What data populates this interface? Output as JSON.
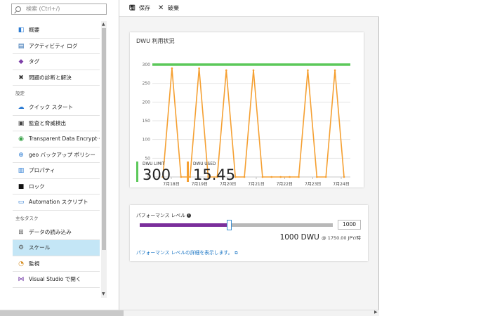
{
  "search": {
    "placeholder": "検索 (Ctrl+/)"
  },
  "toolbar": {
    "save_label": "保存",
    "discard_label": "破棄"
  },
  "sidebar": {
    "items_top": [
      {
        "label": "概要",
        "icon": "overview-icon",
        "glyph": "◧",
        "color": "#2b7bd3"
      },
      {
        "label": "アクティビティ ログ",
        "icon": "activity-log-icon",
        "glyph": "▤",
        "color": "#1a5fa8"
      },
      {
        "label": "タグ",
        "icon": "tag-icon",
        "glyph": "◆",
        "color": "#7d3fa8"
      },
      {
        "label": "問題の診断と解決",
        "icon": "wrench-icon",
        "glyph": "✖",
        "color": "#333333"
      }
    ],
    "section_settings": "設定",
    "items_settings": [
      {
        "label": "クイック スタート",
        "icon": "quickstart-icon",
        "glyph": "☁",
        "color": "#2b7bd3"
      },
      {
        "label": "監査と脅威検出",
        "icon": "audit-icon",
        "glyph": "▣",
        "color": "#444444"
      },
      {
        "label": "Transparent Data Encrypt···",
        "icon": "shield-icon",
        "glyph": "◉",
        "color": "#3aa34a"
      },
      {
        "label": "geo バックアップ ポリシー",
        "icon": "geo-backup-icon",
        "glyph": "⊕",
        "color": "#2b7bd3"
      },
      {
        "label": "プロパティ",
        "icon": "properties-icon",
        "glyph": "▥",
        "color": "#2b7bd3"
      },
      {
        "label": "ロック",
        "icon": "lock-icon",
        "glyph": "■",
        "color": "#111111"
      },
      {
        "label": "Automation スクリプト",
        "icon": "automation-icon",
        "glyph": "▭",
        "color": "#2b7bd3"
      }
    ],
    "section_tasks": "主なタスク",
    "items_tasks": [
      {
        "label": "データの読み込み",
        "icon": "load-data-icon",
        "glyph": "⊞",
        "color": "#555555"
      },
      {
        "label": "スケール",
        "icon": "gear-icon",
        "glyph": "⚙",
        "color": "#555555"
      },
      {
        "label": "監視",
        "icon": "monitor-icon",
        "glyph": "◔",
        "color": "#d48a1c"
      },
      {
        "label": "Visual Studio で開く",
        "icon": "visual-studio-icon",
        "glyph": "⋈",
        "color": "#6b2fa0"
      }
    ]
  },
  "chart_card": {
    "title": "DWU 利用状況",
    "limit_label": "DWU LIMIT",
    "limit_value": "300",
    "used_label": "DWU USED",
    "used_value": "15.45"
  },
  "chart_data": {
    "type": "line",
    "ylim": [
      0,
      300
    ],
    "yticks": [
      "0",
      "50",
      "100",
      "150",
      "200",
      "250",
      "300"
    ],
    "xlabels": [
      "7月18日",
      "7月19日",
      "7月20日",
      "7月21日",
      "7月22日",
      "7月23日",
      "7月24日"
    ],
    "series": [
      {
        "color": "#5cc85a",
        "values": [
          300,
          300
        ]
      },
      {
        "color": "#f5a032",
        "values": [
          0,
          290,
          0,
          0,
          290,
          0,
          0,
          285,
          0,
          0,
          285,
          0,
          0,
          0,
          0,
          0,
          285,
          0,
          0,
          285,
          0
        ]
      }
    ]
  },
  "scale_card": {
    "title": "パフォーマンス レベル",
    "value": "1000",
    "slider_fraction": 0.46,
    "dwu_text": "1000 DWU",
    "price_text": "@ 1750.00 JPY/時",
    "link_text": "パフォーマンス レベルの詳細を表示します。"
  }
}
